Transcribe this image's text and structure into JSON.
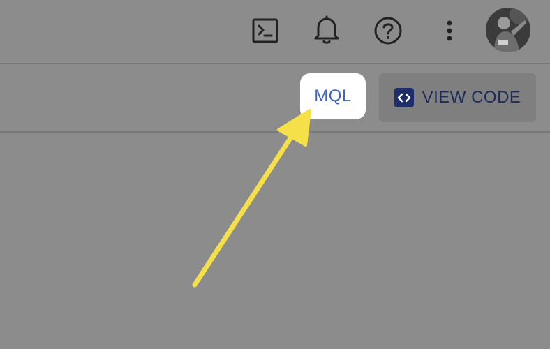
{
  "header": {
    "icons": [
      "terminal-icon",
      "bell-icon",
      "help-icon",
      "more-vertical-icon"
    ],
    "avatar": "user-avatar"
  },
  "toolbar": {
    "mql_label": "MQL",
    "view_code_label": "VIEW CODE"
  },
  "colors": {
    "background": "#8c8c8c",
    "mql_text": "#3f66c4",
    "view_code_text": "#1c2a5c",
    "arrow": "#f6e04a"
  }
}
